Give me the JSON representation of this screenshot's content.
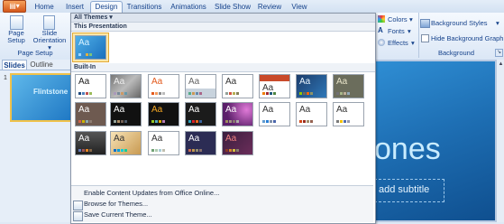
{
  "tabs": [
    {
      "label": "Home",
      "active": false
    },
    {
      "label": "Insert",
      "active": false
    },
    {
      "label": "Design",
      "active": true
    },
    {
      "label": "Transitions",
      "active": false
    },
    {
      "label": "Animations",
      "active": false
    },
    {
      "label": "Slide Show",
      "active": false
    },
    {
      "label": "Review",
      "active": false
    },
    {
      "label": "View",
      "active": false
    }
  ],
  "ribbon": {
    "page_setup_label": "Page Setup",
    "page_setup_line1": "Page",
    "page_setup_line2": "Setup",
    "orientation_line1": "Slide",
    "orientation_line2": "Orientation",
    "colors": "Colors",
    "fonts": "Fonts",
    "effects": "Effects",
    "background_styles": "Background Styles",
    "hide_background": "Hide Background Graphics",
    "background_group": "Background"
  },
  "left_panel": {
    "slides_tab": "Slides",
    "outline_tab": "Outline",
    "slide_number": "1",
    "slide_title": "Flintstone"
  },
  "slide": {
    "title_fragment": "ones",
    "subtitle_placeholder": "add subtitle"
  },
  "dropdown": {
    "header": "All Themes",
    "this_presentation": "This Presentation",
    "built_in": "Built-In",
    "thumb_text": "Aa",
    "menu": [
      {
        "label": "Enable Content Updates from Office Online..."
      },
      {
        "label": "Browse for Themes..."
      },
      {
        "label": "Save Current Theme..."
      }
    ]
  },
  "colors": {
    "accent": "#2a6db5",
    "selection": "#f0c24a"
  }
}
